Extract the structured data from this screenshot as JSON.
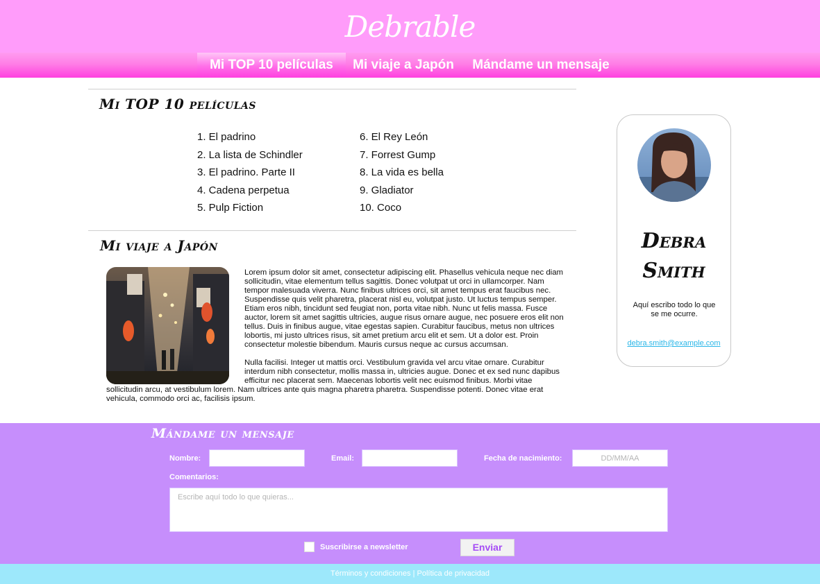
{
  "header": {
    "logo": "Debrable"
  },
  "nav": {
    "items": [
      {
        "label": "Mi TOP 10 películas"
      },
      {
        "label": "Mi viaje a Japón"
      },
      {
        "label": "Mándame un mensaje"
      }
    ]
  },
  "top10": {
    "title": "Mi TOP 10 películas",
    "movies": [
      "1. El padrino",
      "2. La lista de Schindler",
      "3. El padrino. Parte II",
      "4. Cadena perpetua",
      "5. Pulp Fiction",
      "6. El Rey León",
      "7. Forrest Gump",
      "8. La vida es bella",
      "9. Gladiator",
      "10. Coco"
    ]
  },
  "japan": {
    "title": "Mi viaje a Japón",
    "paragraphs": [
      "Lorem ipsum dolor sit amet, consectetur adipiscing elit. Phasellus vehicula neque nec diam sollicitudin, vitae elementum tellus sagittis. Donec volutpat ut orci in ullamcorper. Nam tempor malesuada viverra. Nunc finibus ultrices orci, sit amet tempus erat faucibus nec. Suspendisse quis velit pharetra, placerat nisl eu, volutpat justo. Ut luctus tempus semper. Etiam eros nibh, tincidunt sed feugiat non, porta vitae nibh. Nunc ut felis massa. Fusce auctor, lorem sit amet sagittis ultricies, augue risus ornare augue, nec posuere eros elit non tellus. Duis in finibus augue, vitae egestas sapien. Curabitur faucibus, metus non ultrices lobortis, mi justo ultrices risus, sit amet pretium arcu elit et sem. Ut a dolor est. Proin consectetur molestie bibendum. Mauris cursus neque ac cursus accumsan.",
      "Nulla facilisi. Integer ut mattis orci. Vestibulum gravida vel arcu vitae ornare. Curabitur interdum nibh consectetur, mollis massa in, ultricies augue. Donec et ex sed nunc dapibus efficitur nec placerat sem. Maecenas lobortis velit nec euismod finibus. Morbi vitae sollicitudin arcu, at vestibulum lorem. Nam ultrices ante quis magna pharetra pharetra. Suspendisse potenti. Donec vitae erat vehicula, commodo orci ac, facilisis ipsum."
    ]
  },
  "profile": {
    "name": "Debra Smith",
    "bio": "Aquí escribo todo lo que se me ocurre.",
    "email": "debra.smith@example.com"
  },
  "contact": {
    "title": "Mándame un mensaje",
    "name_label": "Nombre:",
    "email_label": "Email:",
    "birthdate_label": "Fecha de nacimiento:",
    "birthdate_placeholder": "DD/MM/AA",
    "comments_label": "Comentarios:",
    "comments_placeholder": "Escribe aquí todo lo que quieras...",
    "newsletter_label": "Suscribirse a newsletter",
    "submit_label": "Enviar"
  },
  "footer": {
    "terms": "Términos y condiciones",
    "separator": "|",
    "privacy": "Política de privacidad"
  },
  "colors": {
    "header_bg": "#ff9cfa",
    "nav_accent": "#ff3fe0",
    "contact_bg": "#c68efc",
    "footer_bg": "#9de8fb",
    "link": "#29b6e8",
    "button_text": "#a54cf5"
  }
}
